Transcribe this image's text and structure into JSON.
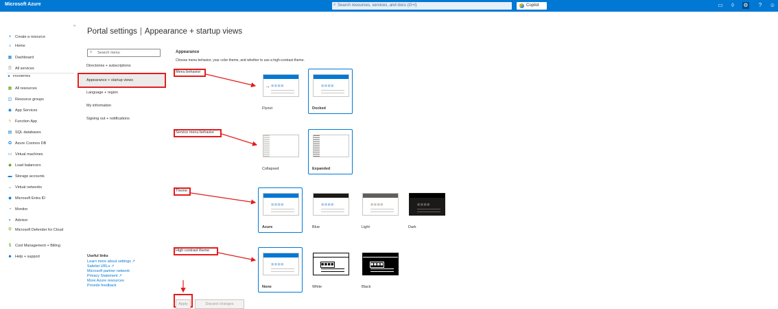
{
  "topbar": {
    "brand": "Microsoft Azure",
    "search_placeholder": "Search resources, services, and docs (G+/)",
    "copilot_label": "Copilot"
  },
  "sidebar": {
    "items": [
      {
        "label": "Create a resource",
        "icon": "plus-icon",
        "color": "#0078d4"
      },
      {
        "label": "Home",
        "icon": "home-icon",
        "color": "#0078d4"
      },
      {
        "label": "Dashboard",
        "icon": "dashboard-icon",
        "color": "#0078d4"
      },
      {
        "label": "All services",
        "icon": "all-services-icon",
        "color": "#8a8886"
      }
    ],
    "favorites_label": "FAVORITES",
    "favorites": [
      {
        "label": "All resources",
        "icon": "all-resources-icon",
        "color": "#57a300"
      },
      {
        "label": "Resource groups",
        "icon": "resource-groups-icon",
        "color": "#0078d4"
      },
      {
        "label": "App Services",
        "icon": "app-services-icon",
        "color": "#0078d4"
      },
      {
        "label": "Function App",
        "icon": "function-app-icon",
        "color": "#f2a900"
      },
      {
        "label": "SQL databases",
        "icon": "sql-databases-icon",
        "color": "#0072c6"
      },
      {
        "label": "Azure Cosmos DB",
        "icon": "cosmos-db-icon",
        "color": "#0078d4"
      },
      {
        "label": "Virtual machines",
        "icon": "virtual-machines-icon",
        "color": "#0078d4"
      },
      {
        "label": "Load balancers",
        "icon": "load-balancers-icon",
        "color": "#57a300"
      },
      {
        "label": "Storage accounts",
        "icon": "storage-accounts-icon",
        "color": "#0078d4"
      },
      {
        "label": "Virtual networks",
        "icon": "virtual-networks-icon",
        "color": "#0078d4"
      },
      {
        "label": "Microsoft Entra ID",
        "icon": "entra-id-icon",
        "color": "#0078d4"
      },
      {
        "label": "Monitor",
        "icon": "monitor-icon",
        "color": "#0078d4"
      },
      {
        "label": "Advisor",
        "icon": "advisor-icon",
        "color": "#0078d4"
      },
      {
        "label": "Microsoft Defender for Cloud",
        "icon": "defender-icon",
        "color": "#57a300"
      },
      {
        "label": "Cost Management + Billing",
        "icon": "cost-management-icon",
        "color": "#57a300"
      },
      {
        "label": "Help + support",
        "icon": "help-support-icon",
        "color": "#0078d4"
      }
    ]
  },
  "page": {
    "title_main": "Portal settings",
    "title_sub": "Appearance + startup views"
  },
  "settings_menu": {
    "search_placeholder": "Search menu",
    "items": [
      "Directories + subscriptions",
      "Appearance + startup views",
      "Language + region",
      "My information",
      "Signing out + notifications"
    ]
  },
  "useful_links": {
    "heading": "Useful links",
    "links": [
      "Learn more about settings ↗",
      "Safelist URLs ↗",
      "Microsoft partner network",
      "Privacy Statement ↗",
      "More Azure resources",
      "Provide feedback"
    ]
  },
  "appearance": {
    "heading": "Appearance",
    "description": "Choose menu behavior, your color theme, and whether to use a high-contrast theme.",
    "menu_behavior_label": "Menu behavior",
    "menu_options": [
      "Flyout",
      "Docked"
    ],
    "service_menu_label": "Service menu behavior",
    "service_options": [
      "Collapsed",
      "Expanded"
    ],
    "theme_label": "Theme",
    "theme_options": [
      "Azure",
      "Blue",
      "Light",
      "Dark"
    ],
    "contrast_label": "High contrast theme",
    "contrast_options": [
      "None",
      "White",
      "Black"
    ]
  },
  "actions": {
    "apply": "Apply",
    "discard": "Discard changes"
  },
  "colors": {
    "accent": "#0078d4",
    "annotation_red": "#e31c1c"
  }
}
